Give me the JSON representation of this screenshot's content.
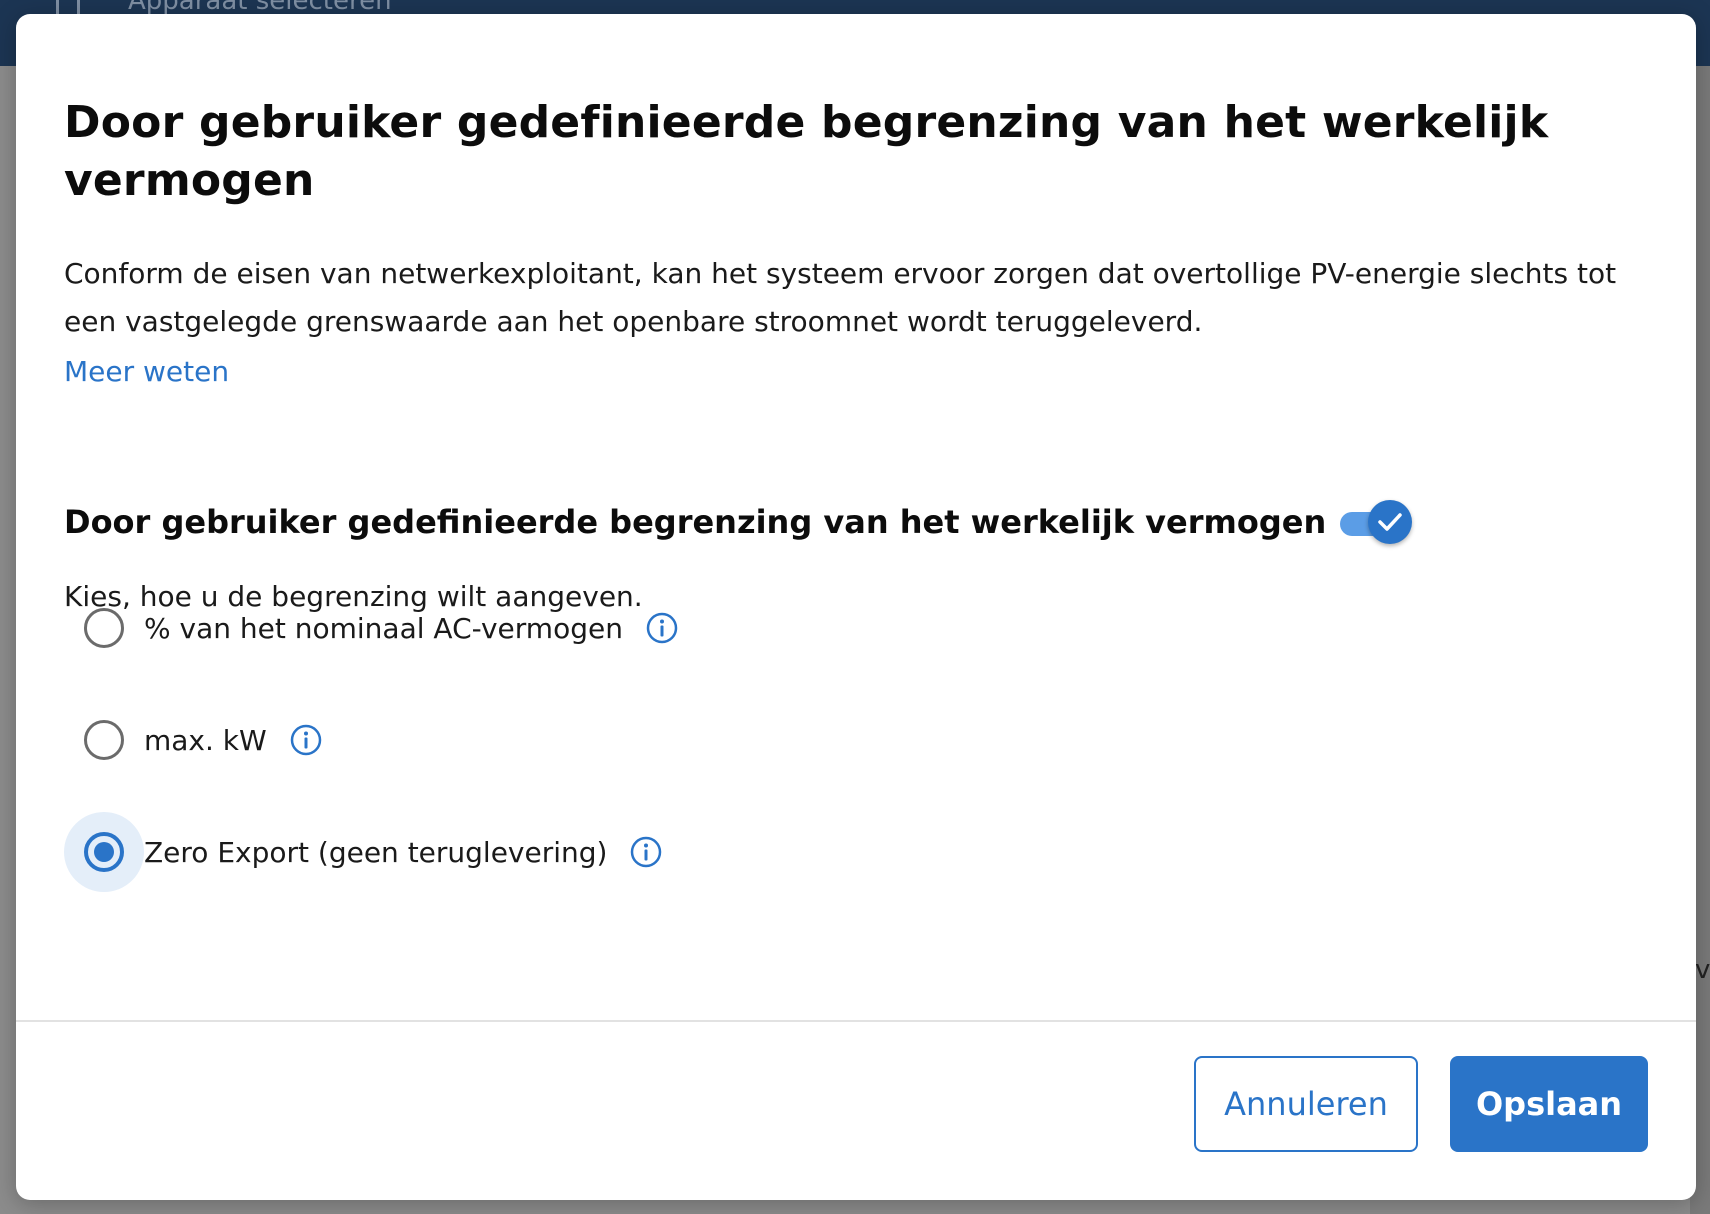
{
  "background": {
    "topbar_label": "Apparaat selecteren",
    "right_edge_text": "va"
  },
  "modal": {
    "title": "Door gebruiker gedefinieerde begrenzing van het werkelijk vermogen",
    "description": "Conform de eisen van netwerkexploitant, kan het systeem ervoor zorgen dat overtollige PV-energie slechts tot een vastgelegde grenswaarde aan het openbare stroomnet wordt teruggeleverd.",
    "learn_more": "Meer weten",
    "section": {
      "heading": "Door gebruiker gedefinieerde begrenzing van het werkelijk vermogen",
      "toggle_on": true
    },
    "instruction": "Kies, hoe u de begrenzing wilt aangeven.",
    "options": [
      {
        "label": "% van het nominaal AC-vermogen",
        "selected": false,
        "icon": "info-icon"
      },
      {
        "label": "max. kW",
        "selected": false,
        "icon": "info-icon"
      },
      {
        "label": "Zero Export (geen teruglevering)",
        "selected": true,
        "icon": "info-icon"
      }
    ],
    "buttons": {
      "cancel": "Annuleren",
      "save": "Opslaan"
    }
  },
  "colors": {
    "accent": "#2a74c8",
    "toggle_track": "#5b9de6",
    "selected_halo": "#e4eef9",
    "topbar": "#1c3553"
  }
}
